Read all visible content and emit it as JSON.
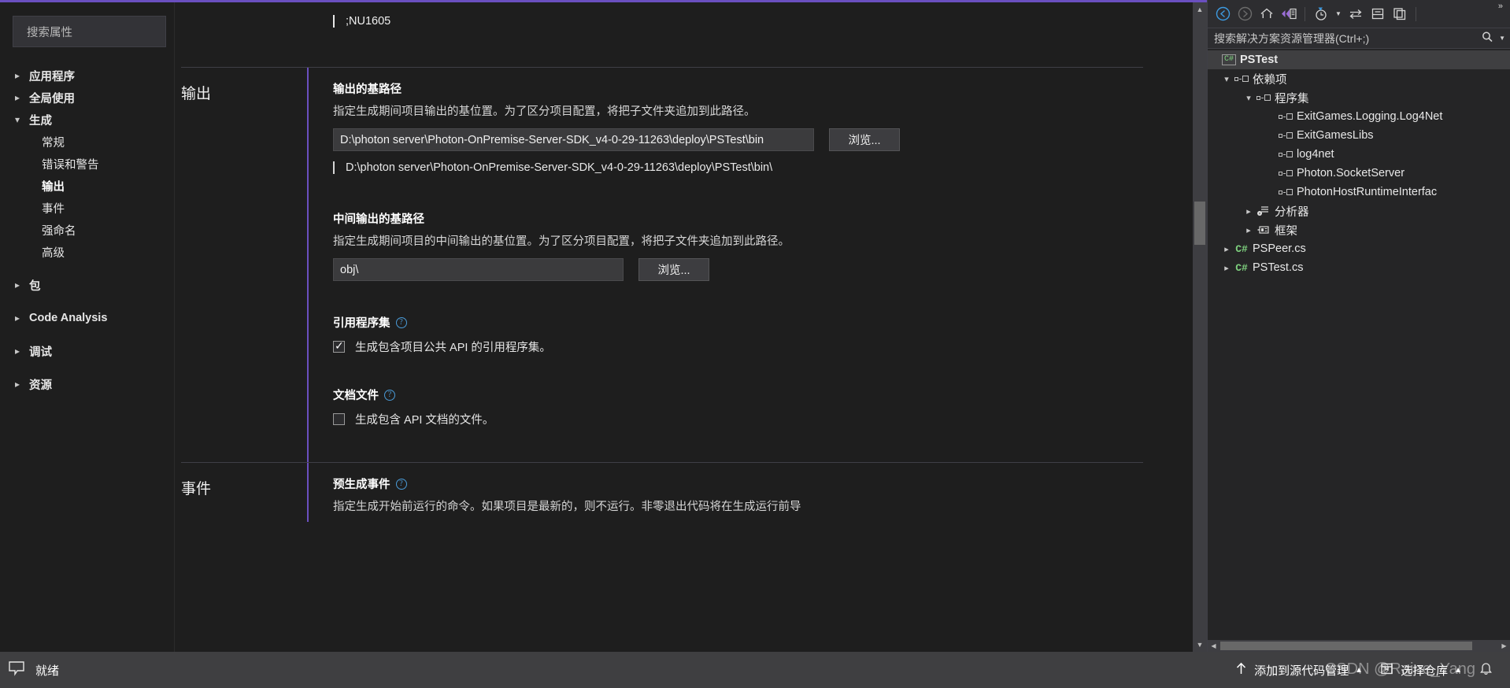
{
  "properties_pane": {
    "search": {
      "placeholder": "搜索属性",
      "value": ""
    },
    "tree": [
      {
        "label": "应用程序",
        "state": "closed",
        "level": 0
      },
      {
        "label": "全局使用",
        "state": "closed",
        "level": 0
      },
      {
        "label": "生成",
        "state": "open",
        "level": 0
      },
      {
        "label": "常规",
        "state": "leaf",
        "level": 1
      },
      {
        "label": "错误和警告",
        "state": "leaf",
        "level": 1
      },
      {
        "label": "输出",
        "state": "leaf",
        "level": 1,
        "selected": true
      },
      {
        "label": "事件",
        "state": "leaf",
        "level": 1
      },
      {
        "label": "强命名",
        "state": "leaf",
        "level": 1
      },
      {
        "label": "高级",
        "state": "leaf",
        "level": 1
      },
      {
        "label": "包",
        "state": "closed",
        "level": 0
      },
      {
        "label": "Code Analysis",
        "state": "closed",
        "level": 0
      },
      {
        "label": "调试",
        "state": "closed",
        "level": 0
      },
      {
        "label": "资源",
        "state": "closed",
        "level": 0
      }
    ]
  },
  "main": {
    "top_fragment": ";NU1605",
    "output_section": {
      "title": "输出",
      "base_path": {
        "label": "输出的基路径",
        "description": "指定生成期间项目输出的基位置。为了区分项目配置，将把子文件夹追加到此路径。",
        "value": "D:\\photon server\\Photon-OnPremise-Server-SDK_v4-0-29-11263\\deploy\\PSTest\\bin",
        "browse_label": "浏览...",
        "resolved": "D:\\photon server\\Photon-OnPremise-Server-SDK_v4-0-29-11263\\deploy\\PSTest\\bin\\"
      },
      "intermediate_path": {
        "label": "中间输出的基路径",
        "description": "指定生成期间项目的中间输出的基位置。为了区分项目配置，将把子文件夹追加到此路径。",
        "value": "obj\\",
        "browse_label": "浏览..."
      },
      "ref_assemblies": {
        "label": "引用程序集",
        "checkbox_label": "生成包含项目公共 API 的引用程序集。",
        "checked": true
      },
      "doc_file": {
        "label": "文档文件",
        "checkbox_label": "生成包含 API 文档的文件。",
        "checked": false
      }
    },
    "events_section": {
      "title": "事件",
      "pre_build": {
        "label": "预生成事件",
        "description": "指定生成开始前运行的命令。如果项目是最新的，则不运行。非零退出代码将在生成运行前导"
      }
    }
  },
  "solution_explorer": {
    "toolbar": {
      "back": "back-arrow",
      "forward": "forward-arrow",
      "home": "home",
      "vs_icon": "visual-studio",
      "pending_changes": "pending-changes-clock",
      "sync": "sync-with-active-document",
      "collapse": "collapse-all",
      "properties": "show-all-files",
      "overflow": "»"
    },
    "search": {
      "placeholder": "搜索解决方案资源管理器(Ctrl+;)",
      "value": ""
    },
    "tree": [
      {
        "label": "PSTest",
        "icon": "csharp-project",
        "level": 0,
        "state": "leaf",
        "selected": true,
        "bold": true
      },
      {
        "label": "依赖项",
        "icon": "dependencies",
        "level": 1,
        "state": "open"
      },
      {
        "label": "程序集",
        "icon": "assembly",
        "level": 2,
        "state": "open"
      },
      {
        "label": "ExitGames.Logging.Log4Net",
        "icon": "assembly",
        "level": 3,
        "state": "leaf"
      },
      {
        "label": "ExitGamesLibs",
        "icon": "assembly",
        "level": 3,
        "state": "leaf"
      },
      {
        "label": "log4net",
        "icon": "assembly",
        "level": 3,
        "state": "leaf"
      },
      {
        "label": "Photon.SocketServer",
        "icon": "assembly",
        "level": 3,
        "state": "leaf"
      },
      {
        "label": "PhotonHostRuntimeInterfac",
        "icon": "assembly",
        "level": 3,
        "state": "leaf"
      },
      {
        "label": "分析器",
        "icon": "analyzers",
        "level": 2,
        "state": "closed"
      },
      {
        "label": "框架",
        "icon": "framework",
        "level": 2,
        "state": "closed"
      },
      {
        "label": "PSPeer.cs",
        "icon": "csharp-file",
        "level": 1,
        "state": "closed"
      },
      {
        "label": "PSTest.cs",
        "icon": "csharp-file",
        "level": 1,
        "state": "closed"
      }
    ]
  },
  "status_bar": {
    "ready": "就绪",
    "source_control": "添加到源代码管理",
    "select_repo": "选择仓库",
    "watermark": "CSDN @Raine_Yang"
  },
  "colors": {
    "accent": "#6a4fbf",
    "background": "#1e1e1e",
    "panel": "#252526",
    "status_bar": "#3f3f41",
    "link": "#4a9bd8",
    "csharp_green": "#7ed07e"
  }
}
